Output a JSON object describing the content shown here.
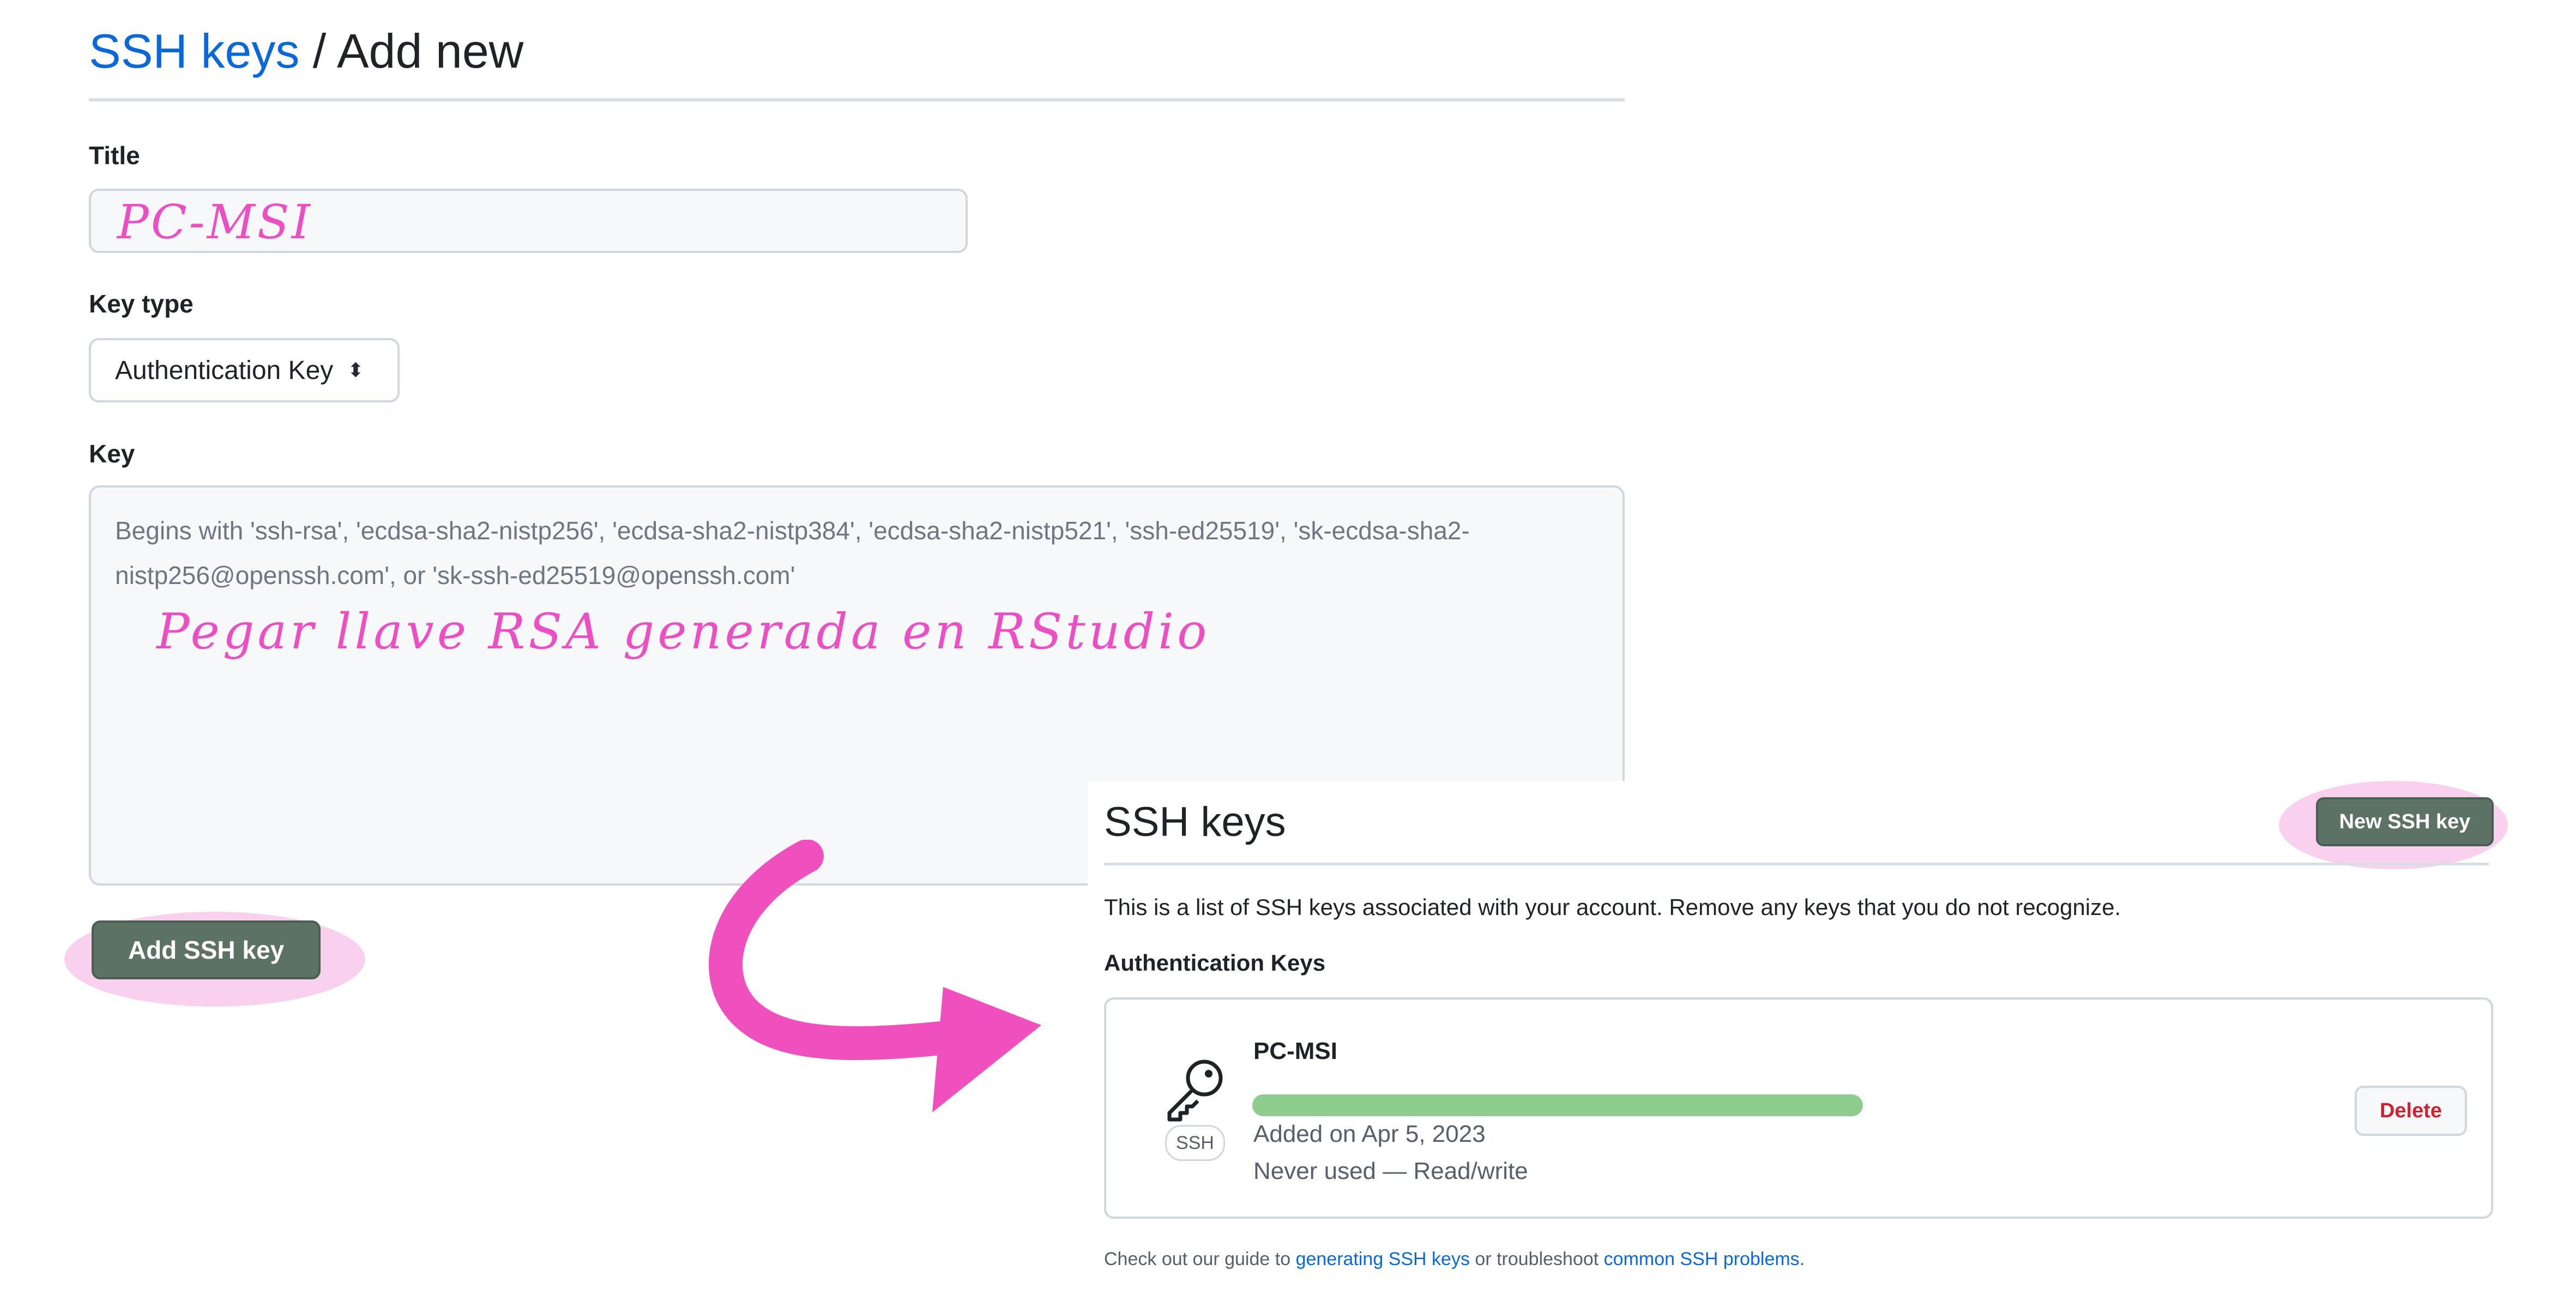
{
  "add_form": {
    "breadcrumb": {
      "link": "SSH keys",
      "separator": " / ",
      "current": "Add new"
    },
    "title_label": "Title",
    "title_annotation": "PC-MSI",
    "key_type_label": "Key type",
    "key_type_value": "Authentication Key",
    "key_label": "Key",
    "key_placeholder": "Begins with 'ssh-rsa', 'ecdsa-sha2-nistp256', 'ecdsa-sha2-nistp384', 'ecdsa-sha2-nistp521', 'ssh-ed25519', 'sk-ecdsa-sha2-nistp256@openssh.com', or 'sk-ssh-ed25519@openssh.com'",
    "key_annotation": "Pegar llave RSA generada en RStudio",
    "submit_label": "Add SSH key"
  },
  "ssh_list": {
    "title": "SSH keys",
    "new_button": "New SSH key",
    "description": "This is a list of SSH keys associated with your account. Remove any keys that you do not recognize.",
    "section_label": "Authentication Keys",
    "keys": [
      {
        "name": "PC-MSI",
        "badge": "SSH",
        "added": "Added on Apr 5, 2023",
        "usage": "Never used — Read/write",
        "delete_label": "Delete"
      }
    ],
    "footer": {
      "prefix": "Check out our guide to ",
      "link1": "generating SSH keys",
      "middle": " or troubleshoot ",
      "link2": "common SSH problems",
      "suffix": "."
    }
  },
  "colors": {
    "link": "#0969da",
    "button_green": "#5b7264",
    "annotation_pink": "#ec4fc4",
    "highlight_pink": "#f078d2",
    "redaction_green": "#8fcd8f",
    "danger": "#cf222e"
  },
  "icons": [
    "chevron-updown-icon",
    "key-icon",
    "curved-arrow-icon"
  ]
}
